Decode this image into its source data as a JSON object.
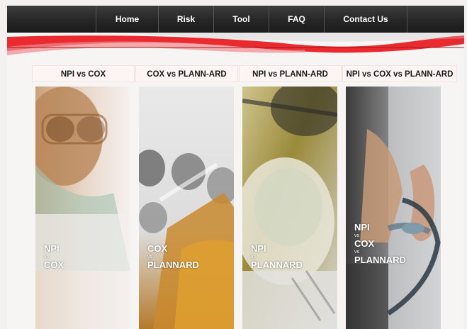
{
  "nav": {
    "items": [
      {
        "label": "Home"
      },
      {
        "label": "Risk"
      },
      {
        "label": "Tool"
      },
      {
        "label": "FAQ"
      },
      {
        "label": "Contact Us"
      }
    ]
  },
  "panels": [
    {
      "title": "NPI vs COX",
      "overlay": [
        "NPI",
        "vs",
        "COX"
      ]
    },
    {
      "title": "COX vs PLANN-ARD",
      "overlay": [
        "COX",
        "vs",
        "PLANNARD"
      ]
    },
    {
      "title": "NPI vs PLANN-ARD",
      "overlay": [
        "NPI",
        "vs",
        "PLANNARD"
      ]
    },
    {
      "title": "NPI vs COX vs PLANN-ARD",
      "overlay": [
        "NPI",
        "vs",
        "COX",
        "vs",
        "PLANNARD"
      ]
    }
  ],
  "colors": {
    "nav_bg": "#262626",
    "accent_red": "#e0151b",
    "panel_title_bg": "#fdf4f4"
  }
}
